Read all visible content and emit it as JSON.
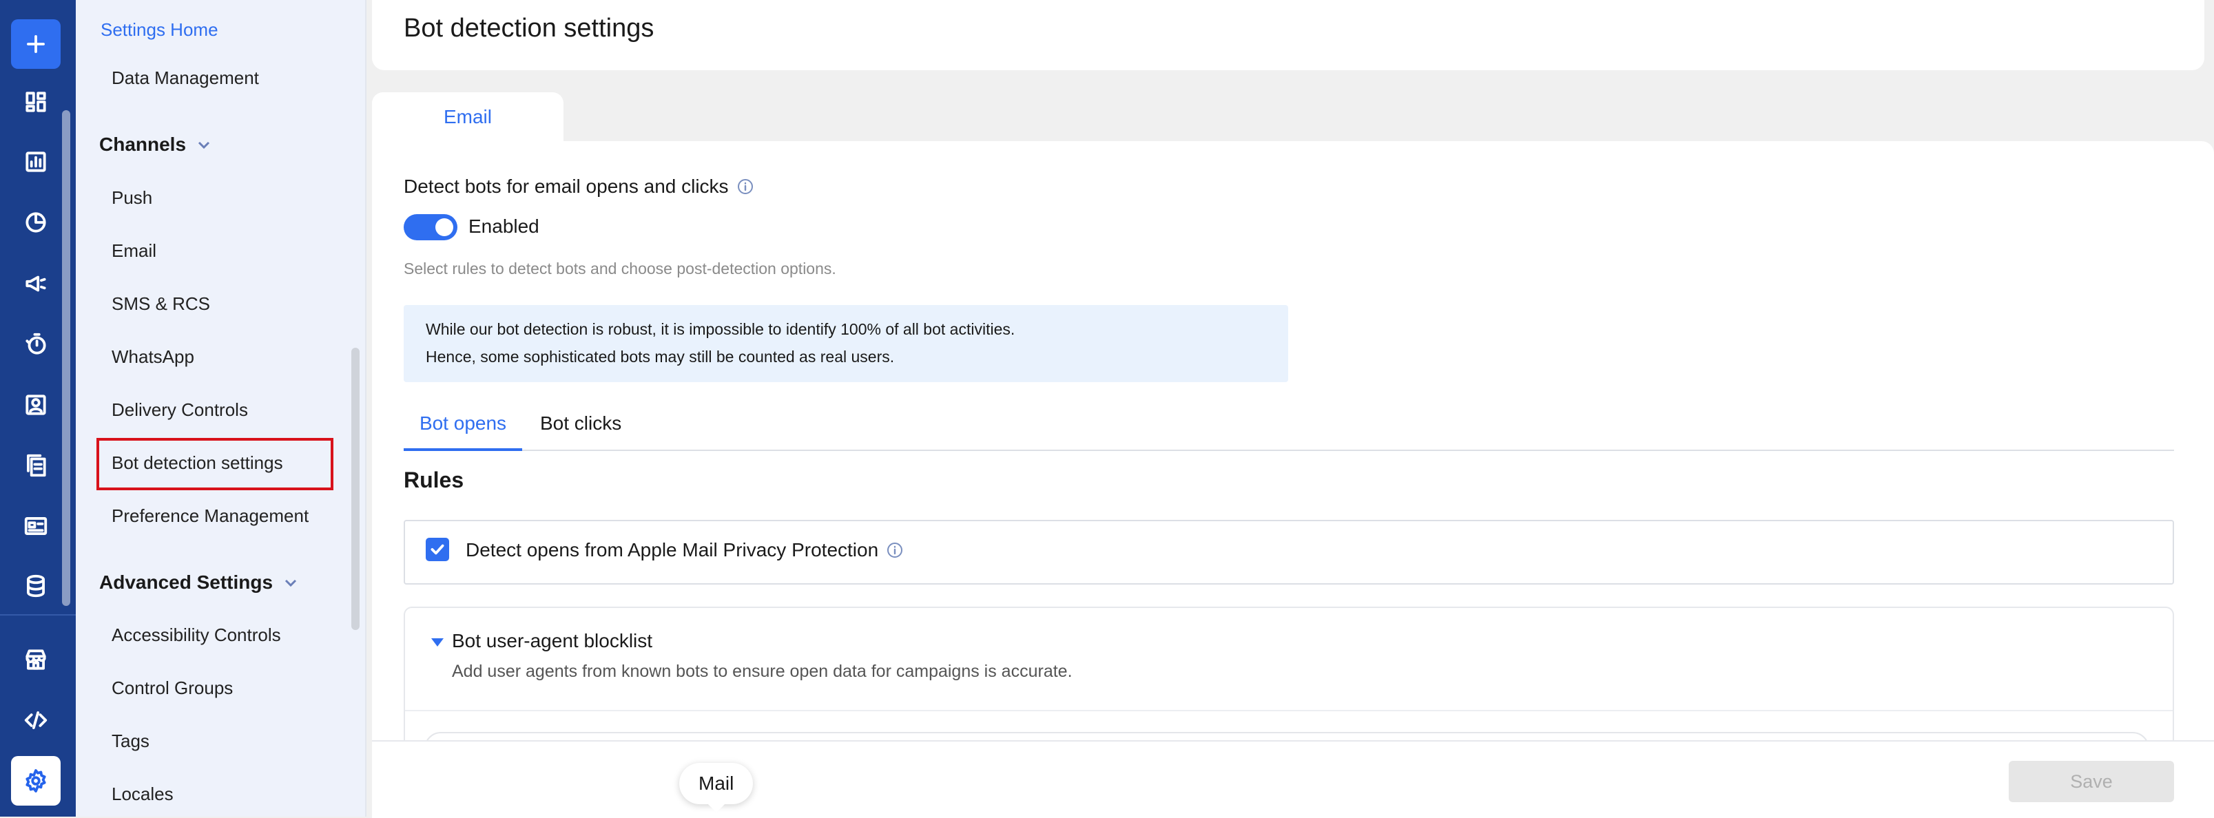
{
  "rail": {
    "icons": [
      "plus-icon",
      "dashboard-icon",
      "analytics-icon",
      "segments-icon",
      "campaigns-icon",
      "flows-icon",
      "user-profile-icon",
      "content-icon",
      "templates-icon",
      "data-icon",
      "app-marketplace-icon",
      "developer-code-icon",
      "settings-gear-icon"
    ]
  },
  "sidebar": {
    "home": "Settings Home",
    "data_management": "Data Management",
    "channels_heading": "Channels",
    "channels": [
      "Push",
      "Email",
      "SMS & RCS",
      "WhatsApp",
      "Delivery Controls",
      "Bot detection settings",
      "Preference Management"
    ],
    "active_item": "Bot detection settings",
    "advanced_heading": "Advanced Settings",
    "advanced": [
      "Accessibility Controls",
      "Control Groups",
      "Tags",
      "Locales"
    ]
  },
  "page": {
    "title": "Bot detection settings",
    "channel_tab": "Email"
  },
  "detect": {
    "title": "Detect bots for email opens and clicks",
    "toggle_on": true,
    "toggle_label": "Enabled",
    "helper": "Select rules to detect bots and choose post-detection options.",
    "banner_line1": "While our bot detection is robust, it is impossible to identify 100% of all bot activities.",
    "banner_line2": "Hence, some sophisticated bots may still be counted as real users."
  },
  "subtabs": {
    "opens": "Bot opens",
    "clicks": "Bot clicks",
    "active": "Bot opens"
  },
  "rules": {
    "title": "Rules",
    "apple_mail_label": "Detect opens from Apple Mail Privacy Protection",
    "apple_mail_checked": true,
    "blocklist_title": "Bot user-agent blocklist",
    "blocklist_desc": "Add user agents from known bots to ensure open data for campaigns is accurate."
  },
  "footer": {
    "save_label": "Save",
    "tooltip": "Mail"
  },
  "colors": {
    "rail": "#1b3f8c",
    "accent": "#2f6ef0",
    "highlight_box": "#d8121b"
  }
}
